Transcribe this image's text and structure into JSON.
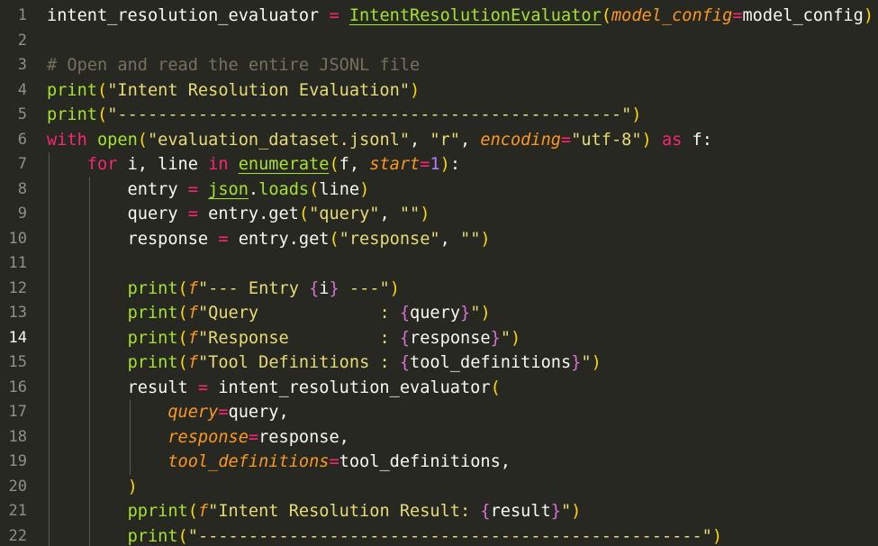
{
  "editor": {
    "language": "python",
    "active_line": 14,
    "colors": {
      "background": "#272822",
      "foreground": "#f8f8f2",
      "keyword": "#f92672",
      "function": "#a6e22e",
      "string": "#e6db74",
      "comment": "#75715e",
      "parameter": "#fd971f",
      "number": "#ae81ff",
      "line_number": "#90908a"
    },
    "lines": [
      {
        "n": "1",
        "tokens": [
          [
            "t",
            "intent_resolution_evaluator "
          ],
          [
            "o",
            "="
          ],
          [
            "t",
            " "
          ],
          [
            "cls",
            "IntentResolutionEvaluator"
          ],
          [
            "b1",
            "("
          ],
          [
            "p",
            "model_config"
          ],
          [
            "o",
            "="
          ],
          [
            "t",
            "model_config"
          ],
          [
            "b1",
            ")"
          ]
        ]
      },
      {
        "n": "2",
        "tokens": []
      },
      {
        "n": "3",
        "tokens": [
          [
            "c",
            "# Open and read the entire JSONL file"
          ]
        ]
      },
      {
        "n": "4",
        "tokens": [
          [
            "f",
            "print"
          ],
          [
            "b1",
            "("
          ],
          [
            "s",
            "\"Intent Resolution Evaluation\""
          ],
          [
            "b1",
            ")"
          ]
        ]
      },
      {
        "n": "5",
        "tokens": [
          [
            "f",
            "print"
          ],
          [
            "b1",
            "("
          ],
          [
            "s",
            "\"--------------------------------------------------\""
          ],
          [
            "b1",
            ")"
          ]
        ]
      },
      {
        "n": "6",
        "tokens": [
          [
            "k",
            "with"
          ],
          [
            "t",
            " "
          ],
          [
            "f",
            "open"
          ],
          [
            "b1",
            "("
          ],
          [
            "s",
            "\"evaluation_dataset.jsonl\""
          ],
          [
            "t",
            ", "
          ],
          [
            "s",
            "\"r\""
          ],
          [
            "t",
            ", "
          ],
          [
            "p",
            "encoding"
          ],
          [
            "o",
            "="
          ],
          [
            "s",
            "\"utf-8\""
          ],
          [
            "b1",
            ")"
          ],
          [
            "t",
            " "
          ],
          [
            "k",
            "as"
          ],
          [
            "t",
            " f:"
          ]
        ]
      },
      {
        "n": "7",
        "tokens": [
          [
            "t",
            "    "
          ],
          [
            "k",
            "for"
          ],
          [
            "t",
            " i, line "
          ],
          [
            "k",
            "in"
          ],
          [
            "t",
            " "
          ],
          [
            "ulf",
            "enumerate"
          ],
          [
            "b1",
            "("
          ],
          [
            "t",
            "f, "
          ],
          [
            "p",
            "start"
          ],
          [
            "o",
            "="
          ],
          [
            "n",
            "1"
          ],
          [
            "b1",
            ")"
          ],
          [
            "t",
            ":"
          ]
        ]
      },
      {
        "n": "8",
        "tokens": [
          [
            "t",
            "        entry "
          ],
          [
            "o",
            "="
          ],
          [
            "t",
            " "
          ],
          [
            "ulf",
            "json"
          ],
          [
            "t",
            "."
          ],
          [
            "f",
            "loads"
          ],
          [
            "b1",
            "("
          ],
          [
            "t",
            "line"
          ],
          [
            "b1",
            ")"
          ]
        ]
      },
      {
        "n": "9",
        "tokens": [
          [
            "t",
            "        query "
          ],
          [
            "o",
            "="
          ],
          [
            "t",
            " entry.get"
          ],
          [
            "b1",
            "("
          ],
          [
            "s",
            "\"query\""
          ],
          [
            "t",
            ", "
          ],
          [
            "s",
            "\"\""
          ],
          [
            "b1",
            ")"
          ]
        ]
      },
      {
        "n": "10",
        "tokens": [
          [
            "t",
            "        response "
          ],
          [
            "o",
            "="
          ],
          [
            "t",
            " entry.get"
          ],
          [
            "b1",
            "("
          ],
          [
            "s",
            "\"response\""
          ],
          [
            "t",
            ", "
          ],
          [
            "s",
            "\"\""
          ],
          [
            "b1",
            ")"
          ]
        ]
      },
      {
        "n": "11",
        "tokens": []
      },
      {
        "n": "12",
        "tokens": [
          [
            "t",
            "        "
          ],
          [
            "f",
            "print"
          ],
          [
            "b1",
            "("
          ],
          [
            "p",
            "f"
          ],
          [
            "s",
            "\"--- Entry "
          ],
          [
            "b2",
            "{"
          ],
          [
            "t",
            "i"
          ],
          [
            "b2",
            "}"
          ],
          [
            "s",
            " ---\""
          ],
          [
            "b1",
            ")"
          ]
        ]
      },
      {
        "n": "13",
        "tokens": [
          [
            "t",
            "        "
          ],
          [
            "f",
            "print"
          ],
          [
            "b1",
            "("
          ],
          [
            "p",
            "f"
          ],
          [
            "s",
            "\"Query            : "
          ],
          [
            "b2",
            "{"
          ],
          [
            "t",
            "query"
          ],
          [
            "b2",
            "}"
          ],
          [
            "s",
            "\""
          ],
          [
            "b1",
            ")"
          ]
        ]
      },
      {
        "n": "14",
        "tokens": [
          [
            "t",
            "        "
          ],
          [
            "f",
            "print"
          ],
          [
            "b1",
            "("
          ],
          [
            "p",
            "f"
          ],
          [
            "s",
            "\"Response         : "
          ],
          [
            "b2",
            "{"
          ],
          [
            "t",
            "response"
          ],
          [
            "b2",
            "}"
          ],
          [
            "s",
            "\""
          ],
          [
            "b1",
            ")"
          ]
        ]
      },
      {
        "n": "15",
        "tokens": [
          [
            "t",
            "        "
          ],
          [
            "f",
            "print"
          ],
          [
            "b1",
            "("
          ],
          [
            "p",
            "f"
          ],
          [
            "s",
            "\"Tool Definitions : "
          ],
          [
            "b2",
            "{"
          ],
          [
            "t",
            "tool_definitions"
          ],
          [
            "b2",
            "}"
          ],
          [
            "s",
            "\""
          ],
          [
            "b1",
            ")"
          ]
        ]
      },
      {
        "n": "16",
        "tokens": [
          [
            "t",
            "        result "
          ],
          [
            "o",
            "="
          ],
          [
            "t",
            " intent_resolution_evaluator"
          ],
          [
            "b1",
            "("
          ]
        ]
      },
      {
        "n": "17",
        "tokens": [
          [
            "t",
            "            "
          ],
          [
            "p",
            "query"
          ],
          [
            "o",
            "="
          ],
          [
            "t",
            "query,"
          ]
        ]
      },
      {
        "n": "18",
        "tokens": [
          [
            "t",
            "            "
          ],
          [
            "p",
            "response"
          ],
          [
            "o",
            "="
          ],
          [
            "t",
            "response,"
          ]
        ]
      },
      {
        "n": "19",
        "tokens": [
          [
            "t",
            "            "
          ],
          [
            "p",
            "tool_definitions"
          ],
          [
            "o",
            "="
          ],
          [
            "t",
            "tool_definitions,"
          ]
        ]
      },
      {
        "n": "20",
        "tokens": [
          [
            "t",
            "        "
          ],
          [
            "b1",
            ")"
          ]
        ]
      },
      {
        "n": "21",
        "tokens": [
          [
            "t",
            "        "
          ],
          [
            "f",
            "pprint"
          ],
          [
            "b1",
            "("
          ],
          [
            "p",
            "f"
          ],
          [
            "s",
            "\"Intent Resolution Result: "
          ],
          [
            "b2",
            "{"
          ],
          [
            "t",
            "result"
          ],
          [
            "b2",
            "}"
          ],
          [
            "s",
            "\""
          ],
          [
            "b1",
            ")"
          ]
        ]
      },
      {
        "n": "22",
        "tokens": [
          [
            "t",
            "        "
          ],
          [
            "f",
            "print"
          ],
          [
            "b1",
            "("
          ],
          [
            "s",
            "\"--------------------------------------------------\""
          ],
          [
            "b1",
            ")"
          ]
        ]
      }
    ]
  }
}
